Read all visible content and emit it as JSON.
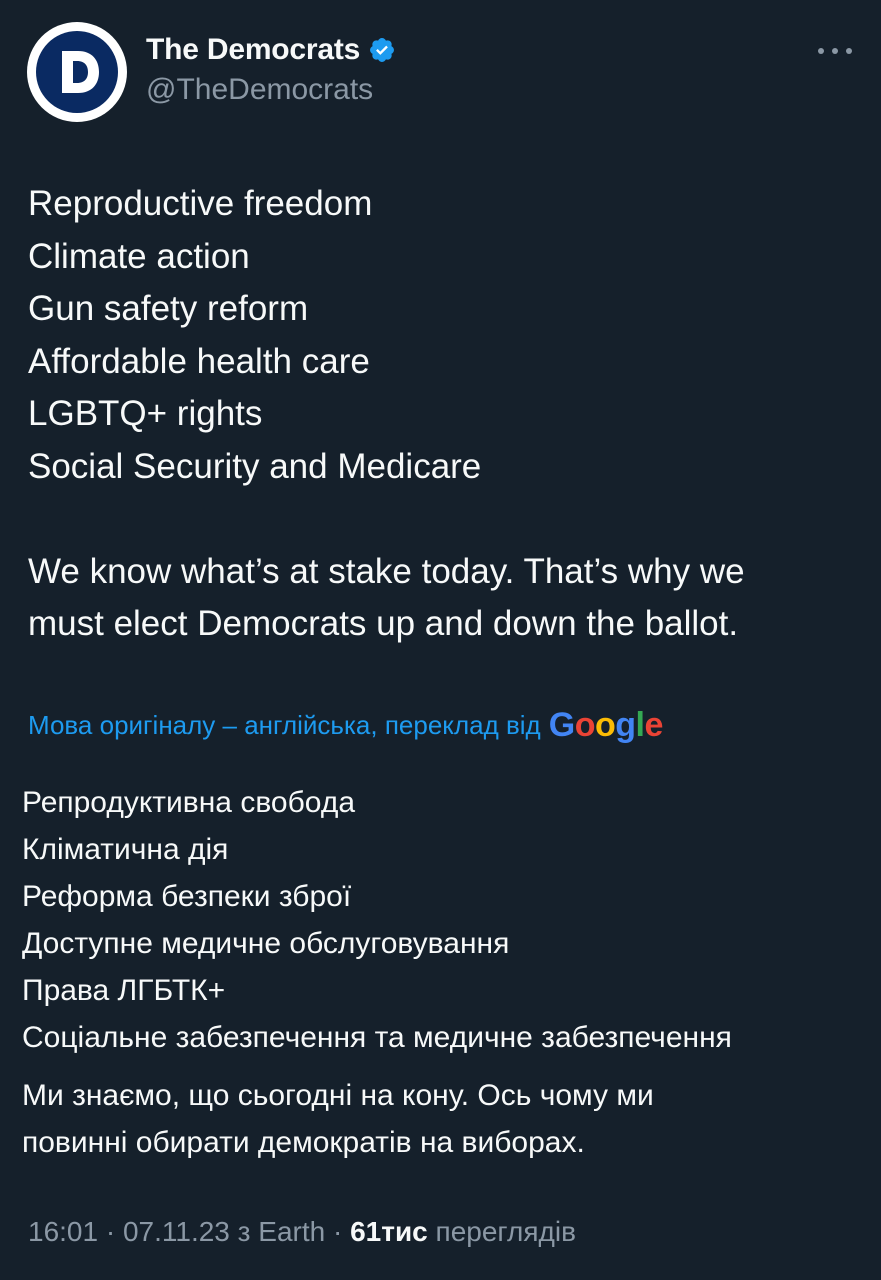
{
  "author": {
    "name": "The Democrats",
    "handle": "@TheDemocrats",
    "avatar_letter": "D",
    "verified": true
  },
  "tweet": {
    "lines": [
      "Reproductive freedom",
      "Climate action",
      "Gun safety reform",
      "Affordable health care",
      "LGBTQ+ rights",
      "Social Security and Medicare"
    ],
    "paragraph2": [
      "We know what’s at stake today. That’s why we",
      "must elect Democrats up and down the ballot."
    ]
  },
  "translation": {
    "notice": "Мова оригіналу – англійська, переклад від",
    "provider": "Google",
    "lines": [
      "Репродуктивна свобода",
      "Кліматична дія",
      "Реформа безпеки зброї",
      "Доступне медичне обслуговування",
      "Права ЛГБТК+",
      "Соціальне забезпечення та медичне забезпечення"
    ],
    "paragraph2": [
      "Ми знаємо, що сьогодні на кону. Ось чому ми",
      "повинні обирати демократів на виборах."
    ]
  },
  "meta": {
    "time": "16:01",
    "separator": " · ",
    "date": "07.11.23",
    "source": "з Earth",
    "views_count": "61тис",
    "views_label": "переглядів"
  },
  "colors": {
    "background": "#15202b",
    "text": "#f7f9f9",
    "secondary": "#8b98a5",
    "link": "#1d9bf0",
    "verified": "#1d9bf0",
    "avatar_blue": "#0a2a62"
  },
  "icons": {
    "verified": "verified-badge-icon",
    "more": "more-options-icon"
  }
}
